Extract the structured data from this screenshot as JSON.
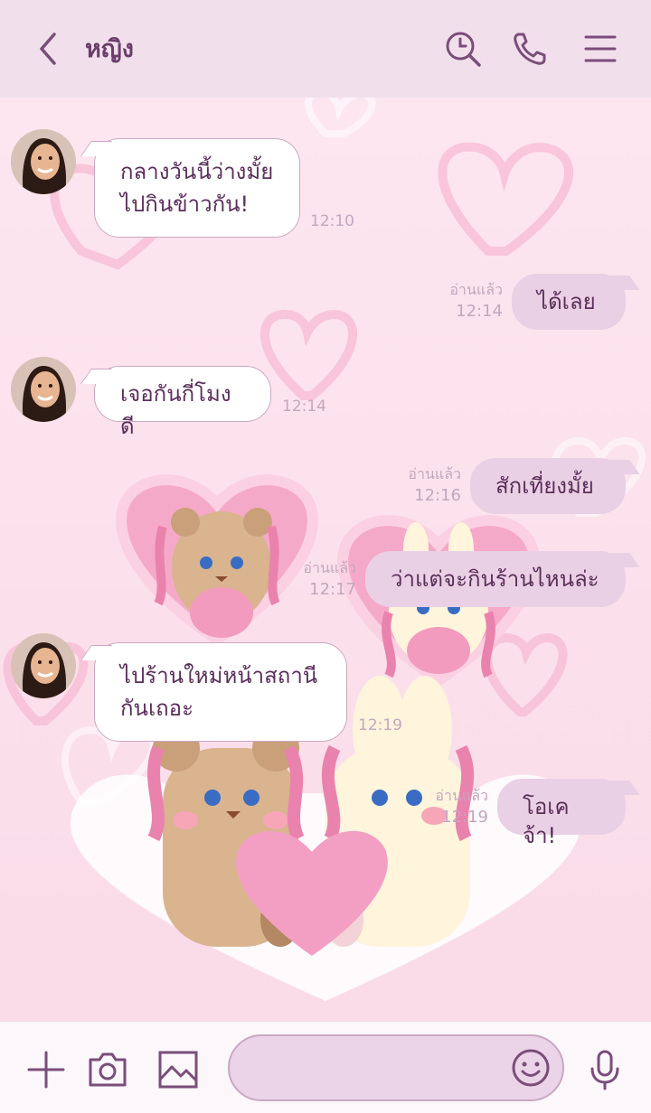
{
  "header": {
    "title": "หญิง",
    "icons": [
      "back-icon",
      "search-icon",
      "phone-icon",
      "menu-icon"
    ]
  },
  "messages": [
    {
      "side": "in",
      "text": "กลางวันนี้ว่างมั้ย\nไปกินข้าวกัน!",
      "time": "12:10"
    },
    {
      "side": "out",
      "text": "ได้เลย",
      "read": "อ่านแล้ว",
      "time": "12:14"
    },
    {
      "side": "in",
      "text": "เจอกันกี่โมงดี",
      "time": "12:14"
    },
    {
      "side": "out",
      "text": "สักเที่ยงมั้ย",
      "read": "อ่านแล้ว",
      "time": "12:16"
    },
    {
      "side": "out",
      "text": "ว่าแต่จะกินร้านไหนล่ะ",
      "read": "อ่านแล้ว",
      "time": "12:17"
    },
    {
      "side": "in",
      "text": "ไปร้านใหม่หน้าสถานี\nกันเถอะ",
      "time": "12:19"
    },
    {
      "side": "out",
      "text": "โอเคจ้า!",
      "read": "อ่านแล้ว",
      "time": "12:19"
    }
  ],
  "footer": {
    "input_placeholder": "",
    "icons": [
      "plus-icon",
      "camera-icon",
      "image-icon",
      "emoji-icon",
      "mic-icon"
    ]
  },
  "colors": {
    "header_bg": "#f1e0ec",
    "accent": "#6b3d6b",
    "bubble_out": "#ead0e4",
    "bubble_in": "#ffffff",
    "chat_bg": "#fbe4ee"
  }
}
